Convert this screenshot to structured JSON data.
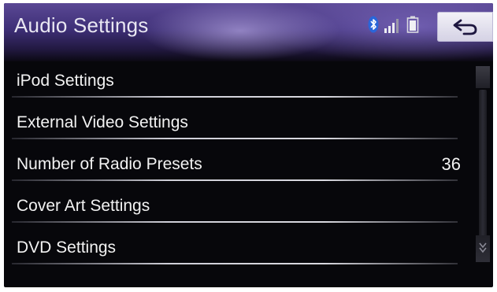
{
  "header": {
    "title": "Audio Settings"
  },
  "status_icons": [
    "bluetooth-icon",
    "signal-strength-icon",
    "battery-icon"
  ],
  "back_button": {
    "icon": "back-arrow-icon"
  },
  "menu": {
    "items": [
      {
        "label": "iPod Settings",
        "value": ""
      },
      {
        "label": "External Video Settings",
        "value": ""
      },
      {
        "label": "Number of Radio Presets",
        "value": "36"
      },
      {
        "label": "Cover Art Settings",
        "value": ""
      },
      {
        "label": "DVD Settings",
        "value": ""
      }
    ]
  },
  "colors": {
    "header_purple": "#3e2f77",
    "background": "#07070b",
    "text": "#f2f2f2"
  }
}
